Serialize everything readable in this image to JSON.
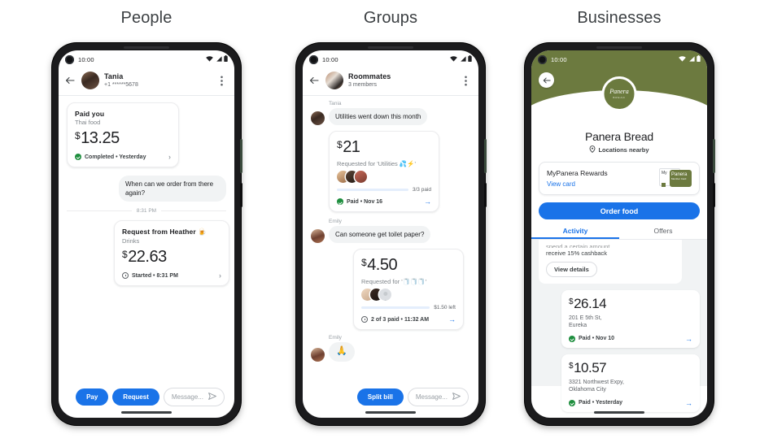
{
  "sections": [
    {
      "id": "people",
      "title": "People"
    },
    {
      "id": "groups",
      "title": "Groups"
    },
    {
      "id": "businesses",
      "title": "Businesses"
    }
  ],
  "status_bar": {
    "time": "10:00",
    "icons": [
      "wifi-icon",
      "signal-icon",
      "battery-icon"
    ]
  },
  "people_screen": {
    "appbar": {
      "back": "back-arrow-icon",
      "avatar": "tania-avatar",
      "title": "Tania",
      "subtitle": "+1 ******5678",
      "more": "more-options-icon"
    },
    "payment_card": {
      "title": "Paid you",
      "note": "Thai food",
      "currency": "$",
      "amount": "13.25",
      "status": "Completed • Yesterday",
      "chevron": "›"
    },
    "message": {
      "text": "When can we order from there again?"
    },
    "time_divider": "8:31 PM",
    "request_card": {
      "title": "Request from Heather",
      "emoji": "🍺",
      "note": "Drinks",
      "currency": "$",
      "amount": "22.63",
      "status": "Started • 8:31 PM",
      "chevron": "›"
    },
    "composer": {
      "pay_label": "Pay",
      "request_label": "Request",
      "message_placeholder": "Message...",
      "send_icon": "send-icon"
    }
  },
  "groups_screen": {
    "appbar": {
      "back": "back-arrow-icon",
      "avatar": "group-avatar",
      "title": "Roommates",
      "subtitle": "3 members",
      "more": "more-options-icon"
    },
    "messages": [
      {
        "sender": "Tania",
        "text": "Utilities went down this month"
      },
      {
        "sender": "Emily",
        "text": "Can someone get toilet paper?"
      },
      {
        "sender": "Emily",
        "text": "🙏"
      }
    ],
    "request_card_1": {
      "currency": "$",
      "amount": "21",
      "description": "Requested for 'Utilities 💦⚡'",
      "progress_percent": 100,
      "progress_label": "3/3 paid",
      "status": "Paid • Nov 16",
      "arrow": "→"
    },
    "request_card_2": {
      "currency": "$",
      "amount": "4.50",
      "description": "Requested for '🧻🧻🧻'",
      "progress_percent": 65,
      "progress_label": "$1.50 left",
      "status": "2 of 3 paid • 11:32 AM",
      "arrow": "→"
    },
    "composer": {
      "split_label": "Split bill",
      "message_placeholder": "Message...",
      "send_icon": "send-icon"
    }
  },
  "business_screen": {
    "back": "back-arrow-icon",
    "logo_word": "Panera",
    "logo_sub": "BREAD",
    "name": "Panera Bread",
    "location": "Locations nearby",
    "location_icon": "map-pin-icon",
    "rewards": {
      "title": "MyPanera Rewards",
      "link": "View card",
      "card_small_label": "My",
      "card_big_label": "Panera",
      "card_big_sub": "Member Card"
    },
    "order_button": "Order food",
    "tabs": [
      {
        "label": "Activity",
        "active": true
      },
      {
        "label": "Offers",
        "active": false
      }
    ],
    "offer": {
      "cut_line": "spend a certain amount",
      "line": "receive 15% cashback",
      "button": "View details"
    },
    "transactions": [
      {
        "currency": "$",
        "amount": "26.14",
        "address_line1": "201 E 5th St,",
        "address_line2": "Eureka",
        "status": "Paid • Nov 10",
        "arrow": "→"
      },
      {
        "currency": "$",
        "amount": "10.57",
        "address_line1": "3321 Northwest Expy,",
        "address_line2": "Oklahoma City",
        "status": "Paid • Yesterday",
        "arrow": "→"
      }
    ]
  },
  "colors": {
    "accent_blue": "#1a73e8",
    "success_green": "#1e8e3e",
    "panera_green": "#6c7a3f",
    "bubble_gray": "#f1f3f4",
    "phone_frame": "#1b1b1d"
  }
}
